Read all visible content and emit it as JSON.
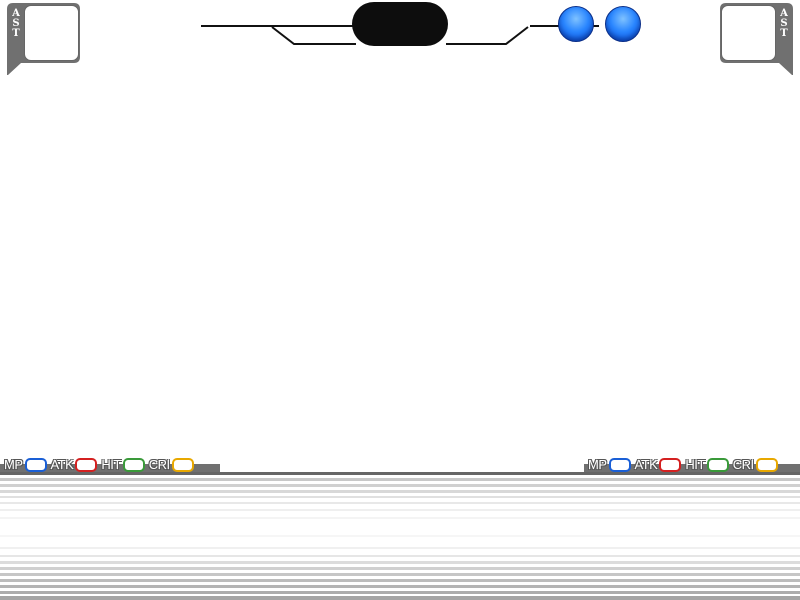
{
  "assist_left": {
    "letters": [
      "A",
      "S",
      "T"
    ]
  },
  "assist_right": {
    "letters": [
      "A",
      "S",
      "T"
    ]
  },
  "round_counter": {
    "orbs": 2,
    "orb_color": "#2a86ff"
  },
  "stats_left": [
    {
      "label": "MP",
      "color": "#1a5fd6"
    },
    {
      "label": "ATK",
      "color": "#d42020"
    },
    {
      "label": "HIT",
      "color": "#3a9a3a"
    },
    {
      "label": "CRI",
      "color": "#e8a800"
    }
  ],
  "stats_right": [
    {
      "label": "MP",
      "color": "#1a5fd6"
    },
    {
      "label": "ATK",
      "color": "#d42020"
    },
    {
      "label": "HIT",
      "color": "#3a9a3a"
    },
    {
      "label": "CRI",
      "color": "#e8a800"
    }
  ],
  "colors": {
    "frame": "#707070",
    "floor_line": "#666666"
  }
}
